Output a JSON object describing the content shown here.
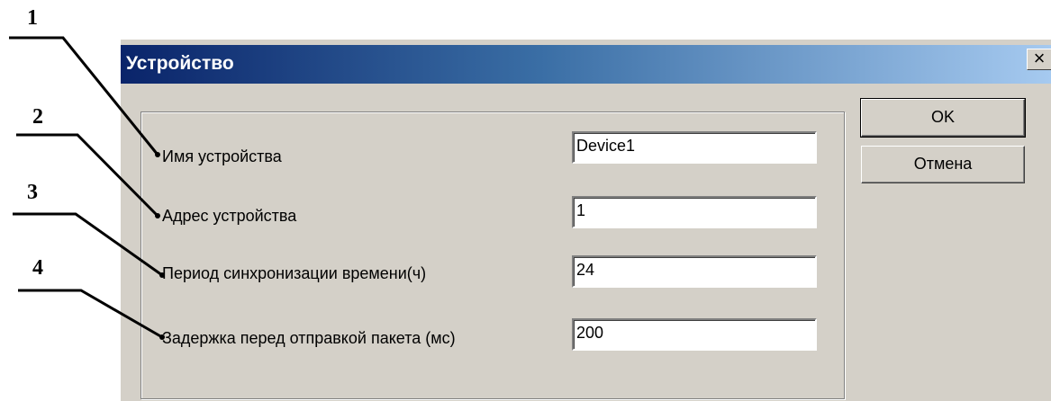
{
  "callouts": [
    "1",
    "2",
    "3",
    "4"
  ],
  "dialog": {
    "title": "Устройство",
    "close_glyph": "×",
    "fields": [
      {
        "label": "Имя устройства",
        "value": "Device1"
      },
      {
        "label": "Адрес устройства",
        "value": "1"
      },
      {
        "label": "Период синхронизации времени(ч)",
        "value": "24"
      },
      {
        "label": "Задержка перед отправкой пакета (мс)",
        "value": "200"
      }
    ],
    "ok_label": "OK",
    "cancel_label": "Отмена"
  },
  "colors": {
    "face": "#d4d0c8",
    "title_start": "#0a246a",
    "title_end": "#a6caf0"
  }
}
